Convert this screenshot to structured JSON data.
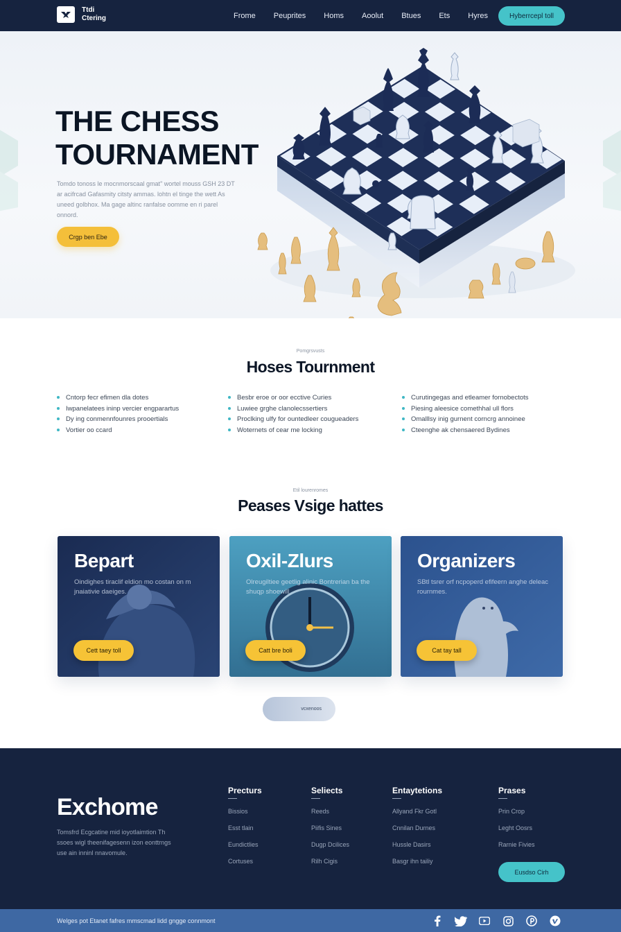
{
  "nav": {
    "logo_line1": "Ttdi",
    "logo_line2": "Ctering",
    "links": [
      "Frome",
      "Peuprites",
      "Homs",
      "Aoolut",
      "Btues",
      "Ets",
      "Hyres"
    ],
    "cta": "Hyberrcepl toll"
  },
  "hero": {
    "title": "THE CHESS TOURNAMENT",
    "description": "Tomdo tonoss le mocnmorscaal gmat\" wortel mouss GSH 23 DT ar acifrcad Gafasmity citsty ammas. lohtn el tinge the wett As uneed golbhox. Ma gage altinc ranfalse oomme en ri parel onnord.",
    "button": "Crgp ben Ebe"
  },
  "features": {
    "label": "Pomgrsvusts",
    "title": "Hoses Tournment",
    "columns": [
      [
        "Cntorp fecr efimen dla dotes",
        "Iwpanelatees ininp vercier engparartus",
        "Dy ing conmennfounres prooertials",
        "Vortier oo ccard"
      ],
      [
        "Besbr eroe or oor ecctive Curies",
        "Luwiee grghe clanolecssertiers",
        "Proclking ulfy for ountedleer cougueaders",
        "Woternets of cear me locking"
      ],
      [
        "Curutingegas and etleamer fornobectots",
        "Piesing aleesice comethhal ull flors",
        "Omalllsy inig gurnent corncrg annoinee",
        "Cteenghe ak chensaered Bydines"
      ]
    ]
  },
  "showcase": {
    "label": "Etil lourenromes",
    "title": "Peases Vsige hattes",
    "cards": [
      {
        "title": "Bepart",
        "text": "Oindighes tiraclif eldion mo costan on m jnaiativie daeiges.",
        "button": "Cett taey toll",
        "bg": "#1d3158"
      },
      {
        "title": "Oxil-Zlurs",
        "text": "Olreugiltiee geetlig alinic Bontrerian ba the shuqp shoewill",
        "button": "Catt bre boli",
        "bg": "#3f8cac"
      },
      {
        "title": "Organizers",
        "text": "SBtl tsrer orf ncpoperd efifeern anghe deleac rournmes.",
        "button": "Cat tay tall",
        "bg": "#2f5793"
      }
    ],
    "pill": "vcxenoos"
  },
  "footer": {
    "brand": "Exchome",
    "description": "Tomsfrd Ecgcatine mid ioyotlaimtion Th ssoes wigl theenifagesenn izon eonttrngs use ain inninl nnavomule.",
    "columns": [
      {
        "heading": "Precturs",
        "links": [
          "Bissios",
          "Esst tlain",
          "Eundictlies",
          "Cortuses"
        ]
      },
      {
        "heading": "Seliects",
        "links": [
          "Reeds",
          "Piifis Sines",
          "Dugp Dcilices",
          "Rilh Cigis"
        ]
      },
      {
        "heading": "Entaytetions",
        "links": [
          "Allyand Fkr Gotl",
          "Cnnilan Durnes",
          "Hussle Dasirs",
          "Basgr ihn tailiy"
        ]
      },
      {
        "heading": "Prases",
        "links": [
          "Prin Crop",
          "Leght Oosrs",
          "Rarnie Fivies"
        ]
      }
    ],
    "cta": "Eusdso Cirh"
  },
  "bottom_bar": {
    "text": "Welges pot Etanet fafres mmscmad lidd gngge connmont",
    "social_icons": [
      "facebook-icon",
      "twitter-icon",
      "youtube-icon",
      "instagram-icon",
      "pinterest-icon",
      "vimeo-icon"
    ]
  }
}
